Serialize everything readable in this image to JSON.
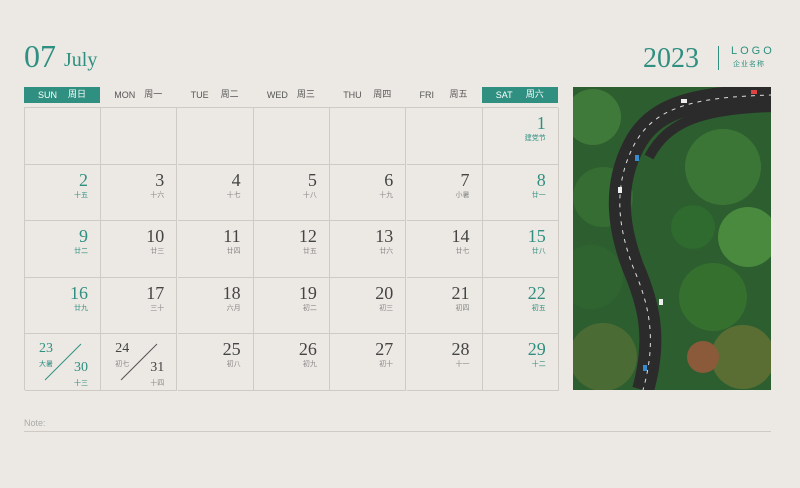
{
  "header": {
    "month_number": "07",
    "month_name": "July",
    "year": "2023",
    "logo": "LOGO",
    "logo_sub": "企业名称"
  },
  "weekdays": [
    {
      "en": "SUN",
      "cn": "周日",
      "highlight": true
    },
    {
      "en": "MON",
      "cn": "周一",
      "highlight": false
    },
    {
      "en": "TUE",
      "cn": "周二",
      "highlight": false
    },
    {
      "en": "WED",
      "cn": "周三",
      "highlight": false
    },
    {
      "en": "THU",
      "cn": "周四",
      "highlight": false
    },
    {
      "en": "FRI",
      "cn": "周五",
      "highlight": false
    },
    {
      "en": "SAT",
      "cn": "周六",
      "highlight": true
    }
  ],
  "days": [
    {
      "d": "",
      "l": ""
    },
    {
      "d": "",
      "l": ""
    },
    {
      "d": "",
      "l": ""
    },
    {
      "d": "",
      "l": ""
    },
    {
      "d": "",
      "l": ""
    },
    {
      "d": "",
      "l": ""
    },
    {
      "d": "1",
      "l": "建党节"
    },
    {
      "d": "2",
      "l": "十五"
    },
    {
      "d": "3",
      "l": "十六"
    },
    {
      "d": "4",
      "l": "十七"
    },
    {
      "d": "5",
      "l": "十八"
    },
    {
      "d": "6",
      "l": "十九"
    },
    {
      "d": "7",
      "l": "小暑"
    },
    {
      "d": "8",
      "l": "廿一"
    },
    {
      "d": "9",
      "l": "廿二"
    },
    {
      "d": "10",
      "l": "廿三"
    },
    {
      "d": "11",
      "l": "廿四"
    },
    {
      "d": "12",
      "l": "廿五"
    },
    {
      "d": "13",
      "l": "廿六"
    },
    {
      "d": "14",
      "l": "廿七"
    },
    {
      "d": "15",
      "l": "廿八"
    },
    {
      "d": "16",
      "l": "廿九"
    },
    {
      "d": "17",
      "l": "三十"
    },
    {
      "d": "18",
      "l": "六月"
    },
    {
      "d": "19",
      "l": "初二"
    },
    {
      "d": "20",
      "l": "初三"
    },
    {
      "d": "21",
      "l": "初四"
    },
    {
      "d": "22",
      "l": "初五"
    },
    {
      "split": true,
      "a": "23",
      "al": "大暑",
      "b": "30",
      "bl": "十三"
    },
    {
      "split": true,
      "a": "24",
      "al": "初七",
      "b": "31",
      "bl": "十四"
    },
    {
      "d": "25",
      "l": "初八"
    },
    {
      "d": "26",
      "l": "初九"
    },
    {
      "d": "27",
      "l": "初十"
    },
    {
      "d": "28",
      "l": "十一"
    },
    {
      "d": "29",
      "l": "十二"
    }
  ],
  "note_label": "Note:",
  "photo_alt": "aerial road through forest"
}
